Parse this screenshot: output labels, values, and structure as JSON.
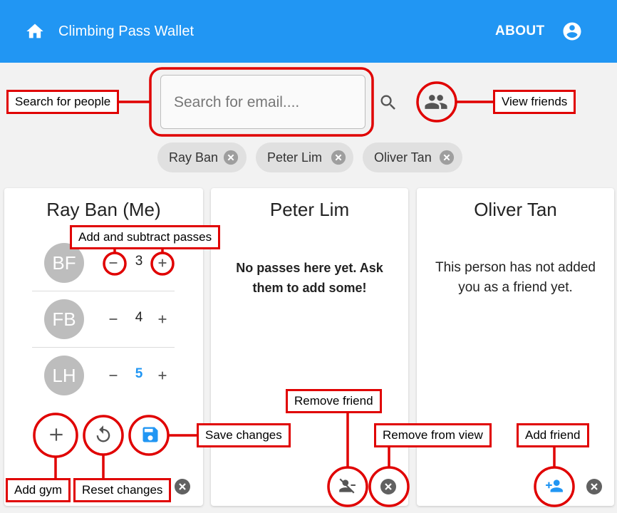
{
  "app": {
    "title": "Climbing Pass Wallet",
    "about_label": "ABOUT"
  },
  "search": {
    "placeholder": "Search for email...."
  },
  "chips": [
    {
      "label": "Ray Ban"
    },
    {
      "label": "Peter Lim"
    },
    {
      "label": "Oliver Tan"
    }
  ],
  "cards": {
    "me": {
      "name": "Ray Ban (Me)",
      "gyms": [
        {
          "initials": "BF",
          "count": "3"
        },
        {
          "initials": "FB",
          "count": "4"
        },
        {
          "initials": "LH",
          "count": "5",
          "changed": true
        }
      ]
    },
    "peter": {
      "name": "Peter Lim",
      "message": "No passes here yet. Ask them to add some!"
    },
    "oliver": {
      "name": "Oliver Tan",
      "message": "This person has not added you as a friend yet."
    }
  },
  "annotations": {
    "search_people": "Search for people",
    "view_friends": "View friends",
    "add_subtract": "Add and subtract passes",
    "remove_friend": "Remove friend",
    "save_changes": "Save changes",
    "remove_from_view": "Remove from view",
    "add_friend": "Add friend",
    "add_gym": "Add gym",
    "reset_changes": "Reset changes"
  },
  "colors": {
    "primary": "#2196f3",
    "annotation": "#e00000",
    "chip": "#e0e0e0",
    "avatar": "#bdbdbd"
  },
  "icons": [
    "home-icon",
    "account-circle-icon",
    "search-icon",
    "group-icon",
    "cancel-icon",
    "minus-icon",
    "plus-icon",
    "add-icon",
    "reset-icon",
    "save-icon",
    "remove-friend-icon",
    "add-friend-icon"
  ]
}
